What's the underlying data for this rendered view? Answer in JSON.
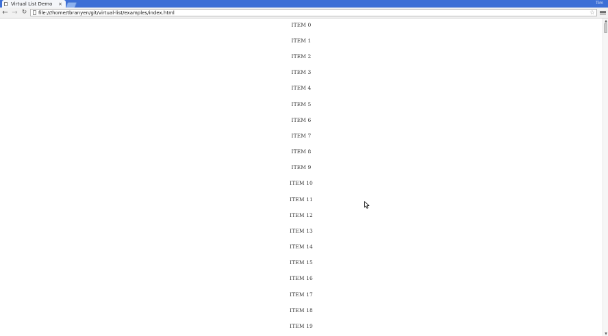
{
  "window": {
    "tab_title": "Virtual List Demo",
    "tab_close": "×",
    "user": "Tim"
  },
  "toolbar": {
    "back_icon": "←",
    "forward_icon": "→",
    "reload_icon": "↻",
    "url": "file:///home/tbranyen/git/virtual-list/examples/index.html",
    "star_icon": "☆"
  },
  "list": {
    "items": [
      "ITEM 0",
      "ITEM 1",
      "ITEM 2",
      "ITEM 3",
      "ITEM 4",
      "ITEM 5",
      "ITEM 6",
      "ITEM 7",
      "ITEM 8",
      "ITEM 9",
      "ITEM 10",
      "ITEM 11",
      "ITEM 12",
      "ITEM 13",
      "ITEM 14",
      "ITEM 15",
      "ITEM 16",
      "ITEM 17",
      "ITEM 18",
      "ITEM 19"
    ]
  },
  "scrollbar": {
    "up_icon": "▲",
    "down_icon": "▼"
  }
}
